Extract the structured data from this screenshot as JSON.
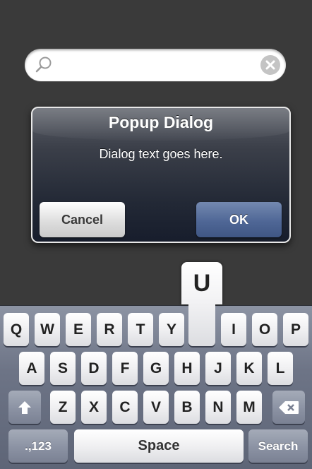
{
  "search": {
    "value": "",
    "placeholder": ""
  },
  "dialog": {
    "title": "Popup Dialog",
    "message": "Dialog text goes here.",
    "cancel_label": "Cancel",
    "ok_label": "OK"
  },
  "keyboard": {
    "popup_key": "U",
    "row1": [
      "Q",
      "W",
      "E",
      "R",
      "T",
      "Y",
      "",
      "I",
      "O",
      "P"
    ],
    "row2": [
      "A",
      "S",
      "D",
      "F",
      "G",
      "H",
      "J",
      "K",
      "L"
    ],
    "row3": [
      "Z",
      "X",
      "C",
      "V",
      "B",
      "N",
      "M"
    ],
    "numbers_label": ".,123",
    "space_label": "Space",
    "search_label": "Search"
  },
  "icons": {
    "search": "magnifier-icon",
    "clear": "clear-x-icon",
    "shift": "shift-arrow-icon",
    "backspace": "backspace-icon"
  },
  "colors": {
    "background": "#3a3a3a",
    "ok_button": "#4f6796",
    "keyboard": "#6d7486"
  }
}
